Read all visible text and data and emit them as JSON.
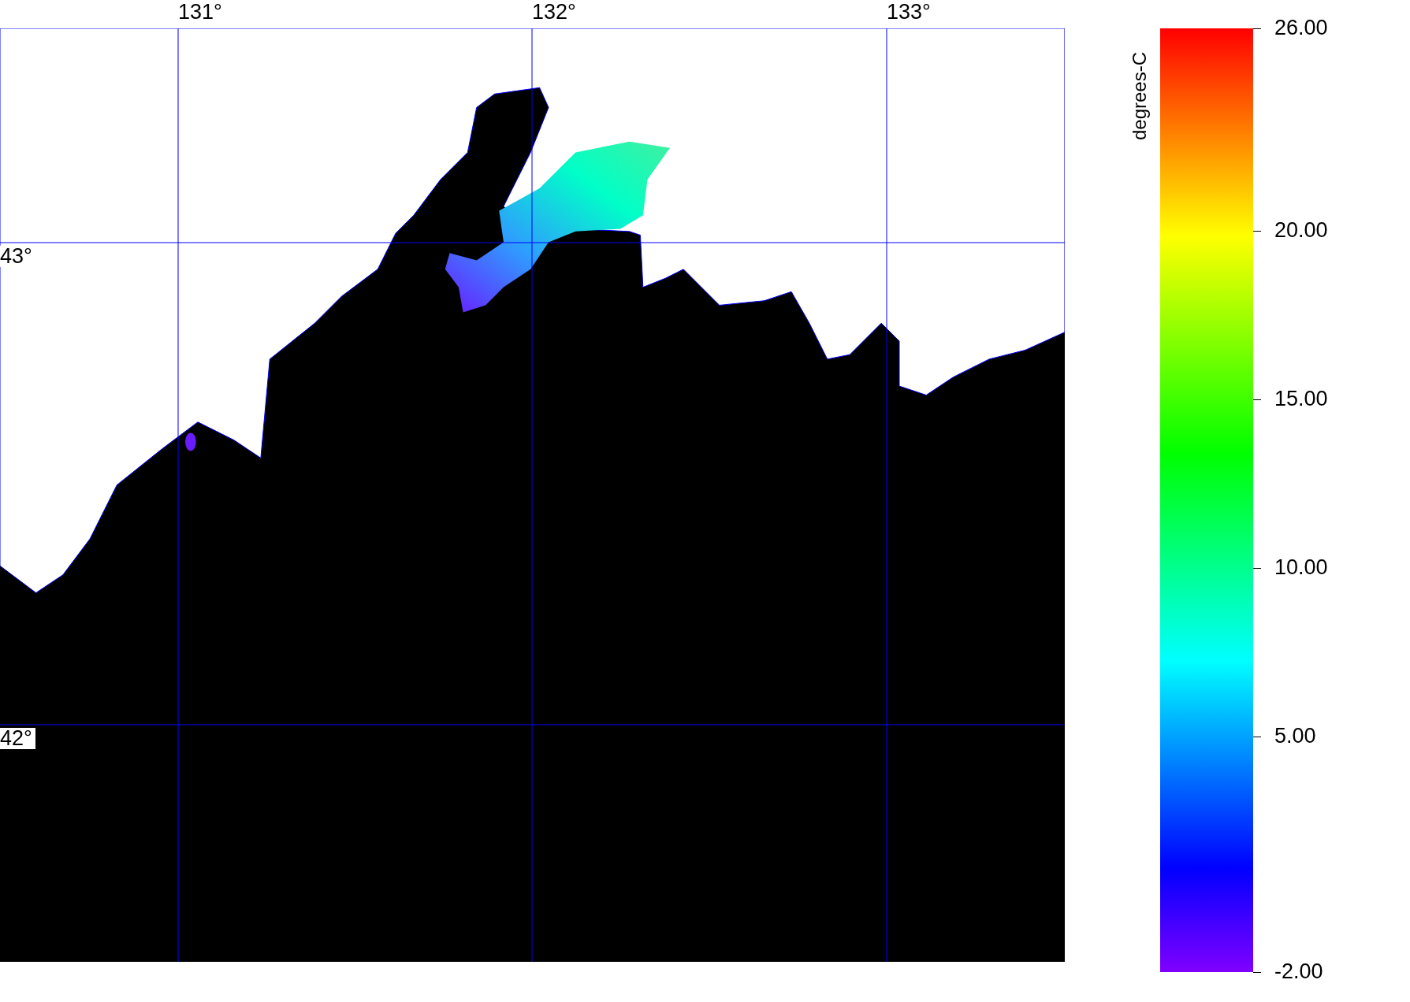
{
  "map": {
    "longitude_labels": [
      "131°",
      "132°",
      "133°"
    ],
    "latitude_labels": [
      "43°",
      "42°"
    ]
  },
  "colorbar": {
    "title": "degrees-C",
    "tick_labels": [
      "26.00",
      "20.00",
      "15.00",
      "10.00",
      "5.00",
      "-2.00"
    ]
  }
}
